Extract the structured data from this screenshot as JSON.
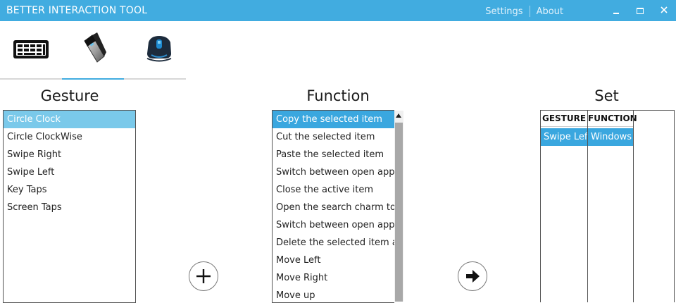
{
  "app": {
    "title": "BETTER INTERACTION TOOL"
  },
  "topbar": {
    "settings": "Settings",
    "about": "About",
    "minimize_glyph": "–",
    "maximize_glyph": "□",
    "close_glyph": "✕"
  },
  "device_tabs": [
    {
      "icon": "keyboard-icon",
      "active": false
    },
    {
      "icon": "handheld-controller-icon",
      "active": true
    },
    {
      "icon": "headset-device-icon",
      "active": false
    }
  ],
  "gesture": {
    "heading": "Gesture",
    "items": [
      "Circle Clock",
      "Circle ClockWise",
      "Swipe Right",
      "Swipe Left",
      "Key Taps",
      "Screen Taps"
    ],
    "selected_index": 0
  },
  "function": {
    "heading": "Function",
    "items": [
      "Copy the selected item",
      "Cut the selected item",
      "Paste the selected item",
      "Switch between open apps",
      "Close the active item",
      "Open the search charm to sear",
      "Switch between open apps (ex",
      "Delete the selected item and n",
      "Move Left",
      "Move Right",
      "Move up"
    ],
    "selected_index": 0
  },
  "buttons": {
    "add": "add-icon",
    "apply": "arrow-right-icon"
  },
  "set": {
    "heading": "Set",
    "columns": [
      "GESTURE",
      "FUNCTION"
    ],
    "rows": [
      {
        "gesture": "Swipe Left",
        "function": "Windows h"
      }
    ]
  },
  "colors": {
    "accent": "#41ace0",
    "selection": "#3aa7df",
    "selection_light": "#7ac9ea"
  }
}
